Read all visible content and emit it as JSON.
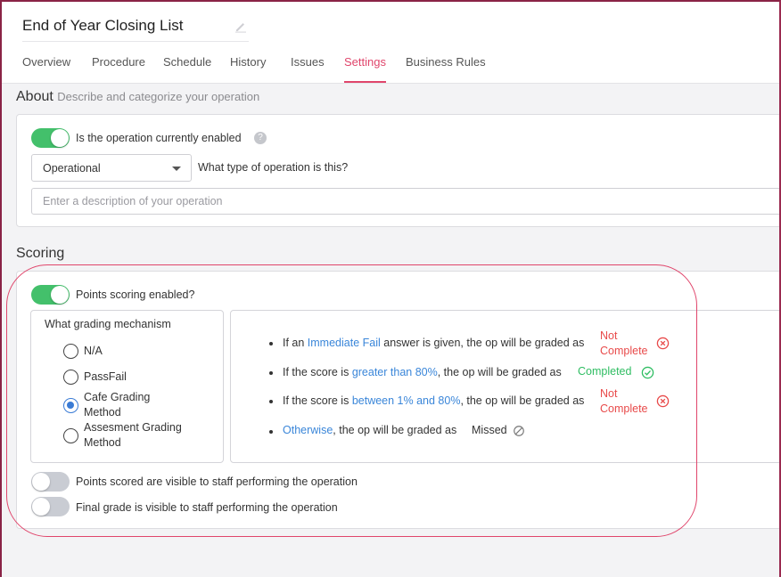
{
  "header": {
    "title": "End of Year Closing List",
    "edit_icon": "pencil-icon",
    "tabs": [
      {
        "label": "Overview",
        "active": false
      },
      {
        "label": "Procedure",
        "active": false
      },
      {
        "label": "Schedule",
        "active": false
      },
      {
        "label": "History",
        "active": false
      },
      {
        "label": "Issues",
        "active": false
      },
      {
        "label": "Settings",
        "active": true
      },
      {
        "label": "Business Rules",
        "active": false
      }
    ],
    "accent_color": "#e0456b"
  },
  "about": {
    "title": "About",
    "subtitle": "Describe and categorize your operation",
    "enabled_label": "Is the operation currently enabled",
    "enabled": true,
    "help_icon": "question-circle-icon",
    "type_select": {
      "value": "Operational"
    },
    "type_question": "What type of operation is this?",
    "description_placeholder": "Enter a description of your operation",
    "description_value": ""
  },
  "scoring": {
    "title": "Scoring",
    "points_enabled_label": "Points scoring enabled?",
    "points_enabled": true,
    "grading": {
      "title": "What grading mechanism",
      "options": [
        {
          "label": "N/A",
          "checked": false
        },
        {
          "label": "PassFail",
          "checked": false
        },
        {
          "label": "Cafe Grading Method",
          "line1": "Cafe Grading",
          "line2": "Method",
          "checked": true
        },
        {
          "label": "Assesment Grading Method",
          "line1": "Assesment Grading",
          "line2": "Method",
          "checked": false
        }
      ]
    },
    "rules": [
      {
        "prefix": "If an ",
        "highlight": "Immediate Fail",
        "suffix": " answer is given, the op will be graded as",
        "status_line1": "Not",
        "status_line2": "Complete",
        "status_icon": "x-circle-icon"
      },
      {
        "prefix": "If the score is ",
        "highlight": "greater than 80%",
        "suffix": ", the op will be graded as",
        "status": "Completed",
        "status_icon": "check-circle-icon"
      },
      {
        "prefix": "If the score is ",
        "highlight": "between 1% and 80%",
        "suffix": ", the op will be graded as",
        "status_line1": "Not",
        "status_line2": "Complete",
        "status_icon": "x-circle-icon"
      },
      {
        "prefix": "",
        "highlight": "Otherwise",
        "suffix": ", the op will be graded as",
        "status": "Missed",
        "status_icon": "slash-circle-icon"
      }
    ],
    "points_visible_label": "Points scored are visible to staff performing the operation",
    "points_visible": false,
    "final_grade_label": "Final grade is visible to staff performing the operation",
    "final_grade_visible": false
  }
}
